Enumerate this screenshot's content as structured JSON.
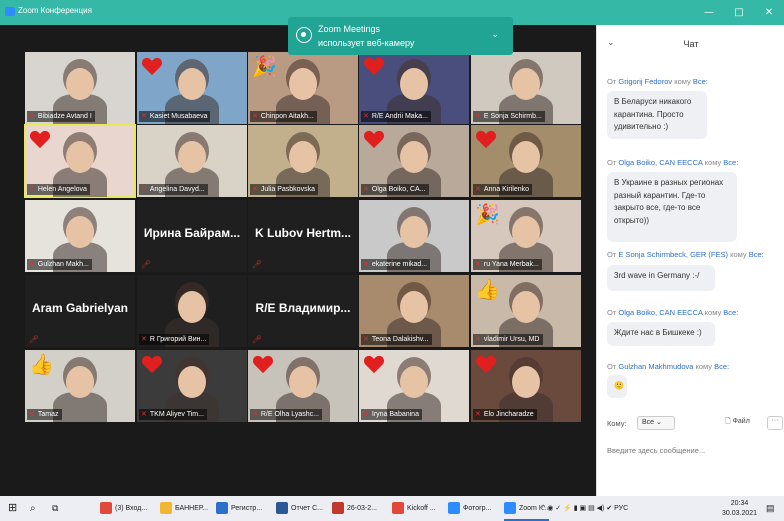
{
  "window": {
    "title": "Zoom Конференция",
    "minimize": "—",
    "maximize": "□",
    "close": "✕"
  },
  "banner": {
    "line1": "Zoom Meetings",
    "line2": "использует веб-камеру",
    "chevron": "⌄"
  },
  "participants": [
    {
      "name": "Bibiadze Avtand I",
      "overlay": "none",
      "bg": "#d8d4cf"
    },
    {
      "name": "Kasiet Musabaeva",
      "overlay": "heart",
      "bg": "#7fa6c9"
    },
    {
      "name": "Chinpon Aitakh...",
      "overlay": "party",
      "bg": "#b99a83"
    },
    {
      "name": "R/E Andrii Maka...",
      "overlay": "heart",
      "bg": "#4a4e7c"
    },
    {
      "name": "E Sonja Schirmb...",
      "overlay": "none",
      "bg": "#cfc9bf"
    },
    {
      "name": "Helen Angelova",
      "overlay": "heart",
      "bg": "#e9d7cf",
      "active": true
    },
    {
      "name": "Angelina Davyd...",
      "overlay": "none",
      "bg": "#d9d3c7"
    },
    {
      "name": "Julia Pasbkovska",
      "overlay": "none",
      "bg": "#c2b08c"
    },
    {
      "name": "Olga Boiko, CA...",
      "overlay": "heart",
      "bg": "#b9a99a"
    },
    {
      "name": "Anna Kirilenko",
      "overlay": "heart",
      "bg": "#a38d6a"
    },
    {
      "name": "Gulzhan Makh...",
      "overlay": "none",
      "bg": "#e6e3dd"
    },
    {
      "name": "Ирина Байрам...",
      "overlay": "text",
      "bg": "#1f1f1f"
    },
    {
      "name": "K Lubov Hertm...",
      "overlay": "text",
      "bg": "#1f1f1f"
    },
    {
      "name": "ekaterine mikad...",
      "overlay": "none",
      "bg": "#c9c9c9"
    },
    {
      "name": "ru Yana Merbak...",
      "overlay": "party",
      "bg": "#d6c8bd"
    },
    {
      "name": "Aram Gabrielyan",
      "overlay": "text",
      "bg": "#1f1f1f"
    },
    {
      "name": "R Григорий Вин...",
      "overlay": "none",
      "bg": "#1f1f1f"
    },
    {
      "name": "R/E Владимир...",
      "overlay": "text",
      "bg": "#1f1f1f"
    },
    {
      "name": "Teona Dalakishv...",
      "overlay": "none",
      "bg": "#a88a6c"
    },
    {
      "name": "vladimir Ursu, MD",
      "overlay": "thumb",
      "bg": "#c8b9a8"
    },
    {
      "name": "Tamaz",
      "overlay": "thumb",
      "bg": "#d3d0ca"
    },
    {
      "name": "TKM Aliyev Tim...",
      "overlay": "heart",
      "bg": "#3b3b3b"
    },
    {
      "name": "R/E Olha Lyashc...",
      "overlay": "heart",
      "bg": "#c7c2ba"
    },
    {
      "name": "Iryna Babanina",
      "overlay": "heart",
      "bg": "#e0d9d2"
    },
    {
      "name": "Elo Jincharadze",
      "overlay": "heart",
      "bg": "#6b4a3e"
    }
  ],
  "chat": {
    "collapse": "⌄",
    "title": "Чат",
    "messages": [
      {
        "prefix": "От",
        "from": "Grigorij Fedorov",
        "mid": "кому",
        "to": "Все:",
        "text": "В Беларуси никакого карантина. Просто удивительно :)"
      },
      {
        "prefix": "От",
        "from": "Olga Boiko, CAN EECCA",
        "mid": "кому",
        "to": "Все:",
        "text": "В Украине в разных регионах разный карантин. Где-то закрыто все, где-то все открыто))"
      },
      {
        "prefix": "От",
        "from": "E Sonja Schirmbeck, GER (FES)",
        "mid": "кому",
        "to": "Все:",
        "text": "3rd wave in Germany :-/"
      },
      {
        "prefix": "От",
        "from": "Olga Boiko, CAN EECCA",
        "mid": "кому",
        "to": "Все:",
        "text": "Ждите нас в Бишкеке :)"
      },
      {
        "prefix": "От",
        "from": "Gulzhan Makhmudova",
        "mid": "кому",
        "to": "Все:",
        "text": "🙂"
      }
    ],
    "to_label": "Кому:",
    "to_value": "Все ⌄",
    "file_label": "Файл",
    "more_label": "···",
    "input_placeholder": "Введите здесь сообщение..."
  },
  "taskbar": {
    "items": [
      {
        "label": "(3) Вход...",
        "color": "#e04a3a"
      },
      {
        "label": "БАННЕР...",
        "color": "#f2b632"
      },
      {
        "label": "Регистр...",
        "color": "#2d6fcc"
      },
      {
        "label": "Отчет С...",
        "color": "#2b5797"
      },
      {
        "label": "26-03-2...",
        "color": "#c0392b"
      },
      {
        "label": "Kickoff ...",
        "color": "#e3473a"
      },
      {
        "label": "Фотогр...",
        "color": "#2d8cff"
      },
      {
        "label": "Zoom К...",
        "color": "#2d8cff"
      }
    ],
    "tray": "^ ◉ ✓ ⚡ ▮ ▣ ▤ ◀) ✔ РУС",
    "time": "20:34",
    "date": "30.03.2021"
  }
}
